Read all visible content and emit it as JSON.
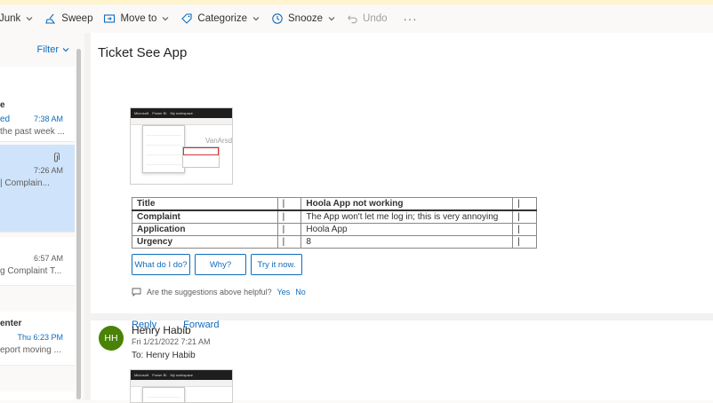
{
  "toolbar": {
    "junk": "Junk",
    "sweep": "Sweep",
    "move_to": "Move to",
    "categorize": "Categorize",
    "snooze": "Snooze",
    "undo": "Undo",
    "more": "···"
  },
  "list": {
    "filter": "Filter",
    "items": [
      {
        "sender": "e",
        "subject": "ed",
        "time": "7:38 AM",
        "preview": "the past week ..."
      },
      {
        "sender": "",
        "subject": "| Complain...",
        "time": "7:26 AM",
        "preview": ""
      },
      {
        "sender": "",
        "subject": "g Complaint T...",
        "time": "6:57 AM",
        "preview": ""
      },
      {
        "sender": "enter",
        "subject": "",
        "time": "Thu 6:23 PM",
        "preview": "eport moving ..."
      }
    ]
  },
  "reading": {
    "subject": "Ticket See App",
    "thumbnail": {
      "brand": "Microsoft",
      "app": "Power BI",
      "workspace": "My workspace",
      "logo": "VanArsdel"
    },
    "table": {
      "header": [
        "Title",
        "|",
        "Hoola App not working",
        "|"
      ],
      "rows": [
        [
          "Complaint",
          "|",
          "The App won't let me log in; this is very annoying",
          "|"
        ],
        [
          "Application",
          "|",
          "Hoola App",
          "|"
        ],
        [
          "Urgency",
          "|",
          "8",
          "|"
        ]
      ]
    },
    "suggestions": [
      "What do I do?",
      "Why?",
      "Try it now."
    ],
    "feedback": {
      "question": "Are the suggestions above helpful?",
      "yes": "Yes",
      "no": "No"
    },
    "reply": "Reply",
    "forward": "Forward",
    "second_message": {
      "initials": "HH",
      "sender": "Henry Habib",
      "date": "Fri 1/21/2022 7:21 AM",
      "to_label": "To:",
      "to": "Henry Habib"
    }
  },
  "colors": {
    "accent": "#0f6cbd",
    "avatar": "#498205",
    "selected": "#cfe4fa"
  }
}
